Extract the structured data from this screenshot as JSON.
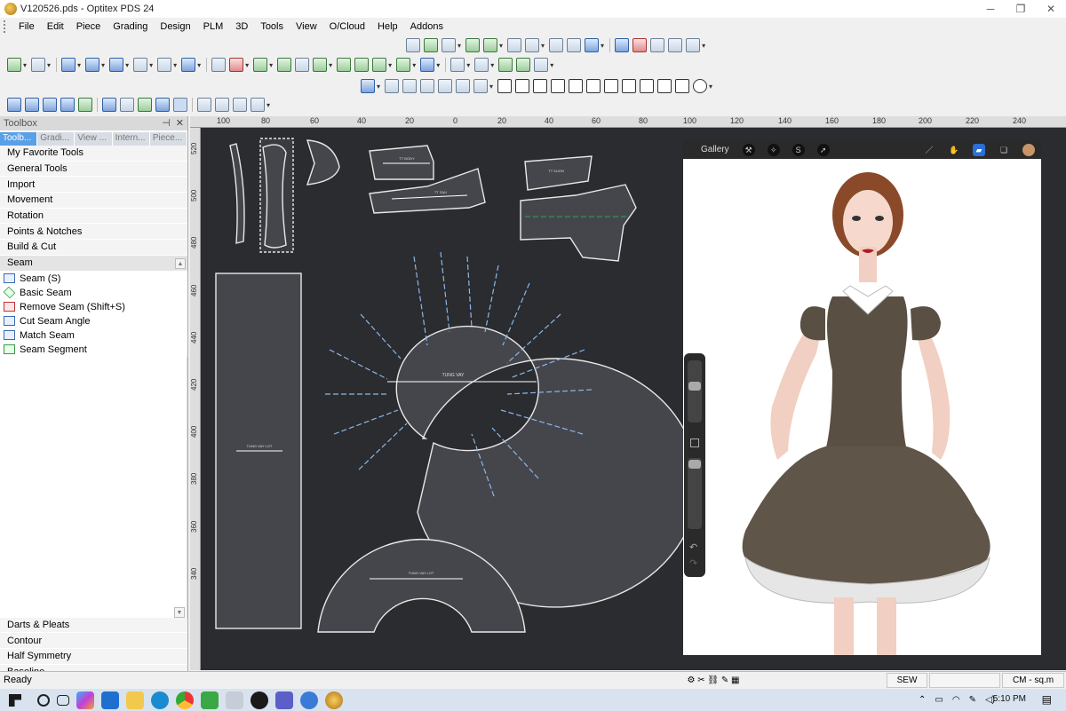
{
  "window": {
    "title": "V120526.pds - Optitex PDS 24"
  },
  "menu": [
    "File",
    "Edit",
    "Piece",
    "Grading",
    "Design",
    "PLM",
    "3D",
    "Tools",
    "View",
    "O/Cloud",
    "Help",
    "Addons"
  ],
  "toolbox": {
    "title": "Toolbox",
    "tabs": [
      "Toolb...",
      "Gradi...",
      "View ...",
      "Intern...",
      "Piece..."
    ],
    "categories_top": [
      "My Favorite Tools",
      "General Tools",
      "Import",
      "Movement",
      "Rotation",
      "Points & Notches",
      "Build & Cut",
      "Seam"
    ],
    "seam_items": [
      "Seam (S)",
      "Basic Seam",
      "Remove Seam (Shift+S)",
      "Cut Seam Angle",
      "Match Seam",
      "Seam Segment"
    ],
    "categories_bottom": [
      "Darts & Pleats",
      "Contour",
      "Half Symmetry",
      "Baseline"
    ]
  },
  "ruler": {
    "top": [
      "100",
      "80",
      "60",
      "40",
      "20",
      "0",
      "20",
      "40",
      "60",
      "80",
      "100",
      "120",
      "140",
      "160",
      "180",
      "200",
      "220",
      "240"
    ],
    "left": [
      "520",
      "500",
      "480",
      "460",
      "440",
      "420",
      "400",
      "380",
      "360",
      "340"
    ]
  },
  "pieces": {
    "ring_label": "TUNG VAY",
    "rect_label": "TUNG VAY LOT",
    "arc_label": "TUNG VAY LOT",
    "front_label": "TT BODY",
    "back_label": "TT SAU",
    "right_top_label": "TT SUON"
  },
  "procreate": {
    "gallery": "Gallery",
    "brush_color": "#c8956a"
  },
  "status": {
    "ready": "Ready",
    "mode": "SEW",
    "units": "CM - sq.m"
  },
  "taskbar": {
    "time": "5:10 PM"
  }
}
